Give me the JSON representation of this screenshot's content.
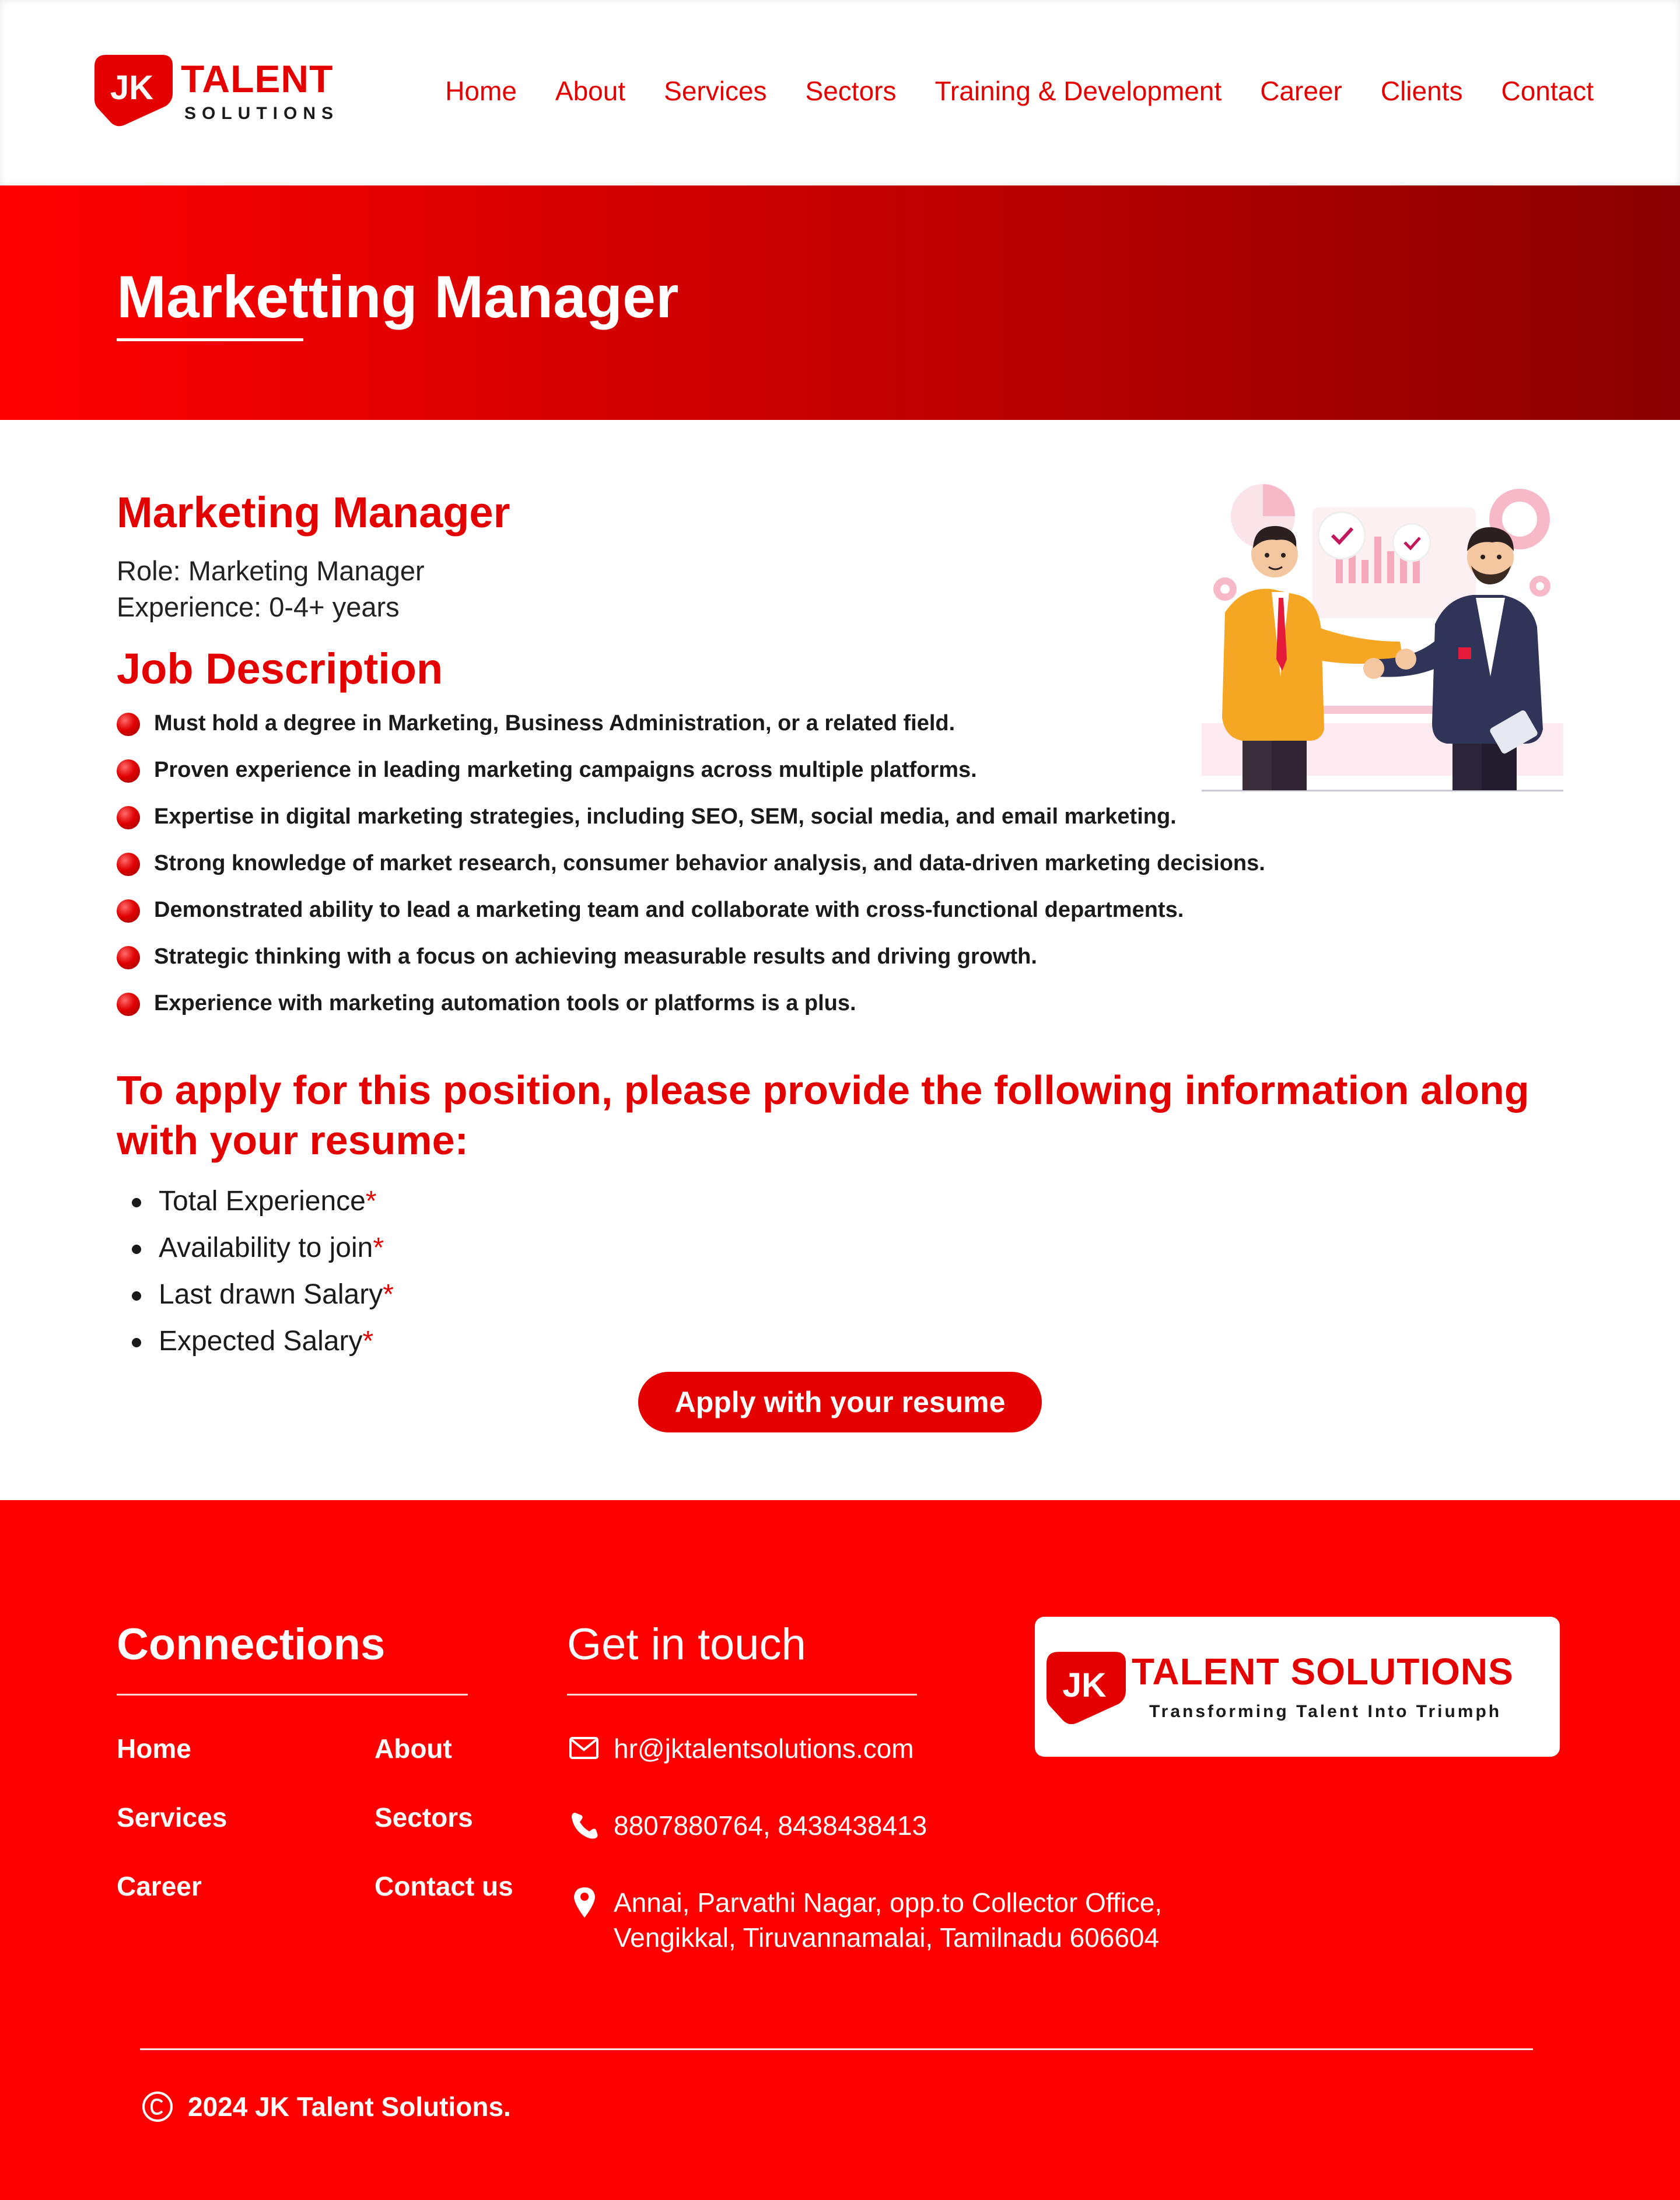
{
  "colors": {
    "brand_red": "#e50000",
    "footer_red": "#ff0000",
    "hero_dark": "#8a0000",
    "text": "#1a1a1a"
  },
  "header": {
    "logo": {
      "badge_text": "JK",
      "name": "TALENT",
      "sub": "SOLUTIONS"
    },
    "nav": [
      "Home",
      "About",
      "Services",
      "Sectors",
      "Training & Development",
      "Career",
      "Clients",
      "Contact"
    ]
  },
  "hero": {
    "title": "Marketting Manager"
  },
  "job": {
    "title": "Marketing Manager",
    "role": "Role: Marketing Manager",
    "experience": "Experience: 0-4+ years",
    "description_title": "Job Description",
    "description": [
      "Must hold a degree in Marketing, Business Administration, or a related field.",
      "Proven experience in leading marketing campaigns across multiple platforms.",
      "Expertise in digital marketing strategies, including SEO, SEM, social media, and email marketing.",
      "Strong knowledge of market research, consumer behavior analysis, and data-driven marketing decisions.",
      "Demonstrated ability to lead a marketing team and collaborate with cross-functional departments.",
      "Strategic thinking with a focus on achieving measurable results and driving growth.",
      "Experience with marketing automation tools or platforms is a plus."
    ],
    "illustration_icon": "handshake-illustration"
  },
  "apply": {
    "title": "To apply for this position, please provide the following information along with your resume:",
    "requirements": [
      "Total Experience",
      "Availability to join",
      "Last drawn Salary",
      "Expected Salary"
    ],
    "required_mark": "*",
    "button": "Apply with your resume"
  },
  "footer": {
    "connections_title": "Connections",
    "links": [
      "Home",
      "About",
      "Services",
      "Sectors",
      "Career",
      "Contact us"
    ],
    "contact_title": "Get in touch",
    "email": "hr@jktalentsolutions.com",
    "phone": "8807880764, 8438438413",
    "address_line1": "Annai, Parvathi Nagar, opp.to Collector Office,",
    "address_line2": "Vengikkal, Tiruvannamalai, Tamilnadu 606604",
    "logo": {
      "badge_text": "JK",
      "name": "TALENT SOLUTIONS",
      "tagline": "Transforming Talent Into Triumph"
    },
    "copyright": "2024 JK Talent Solutions.",
    "icons": {
      "email": "mail-icon",
      "phone": "phone-icon",
      "address": "location-pin-icon",
      "copyright": "copyright-icon"
    }
  }
}
